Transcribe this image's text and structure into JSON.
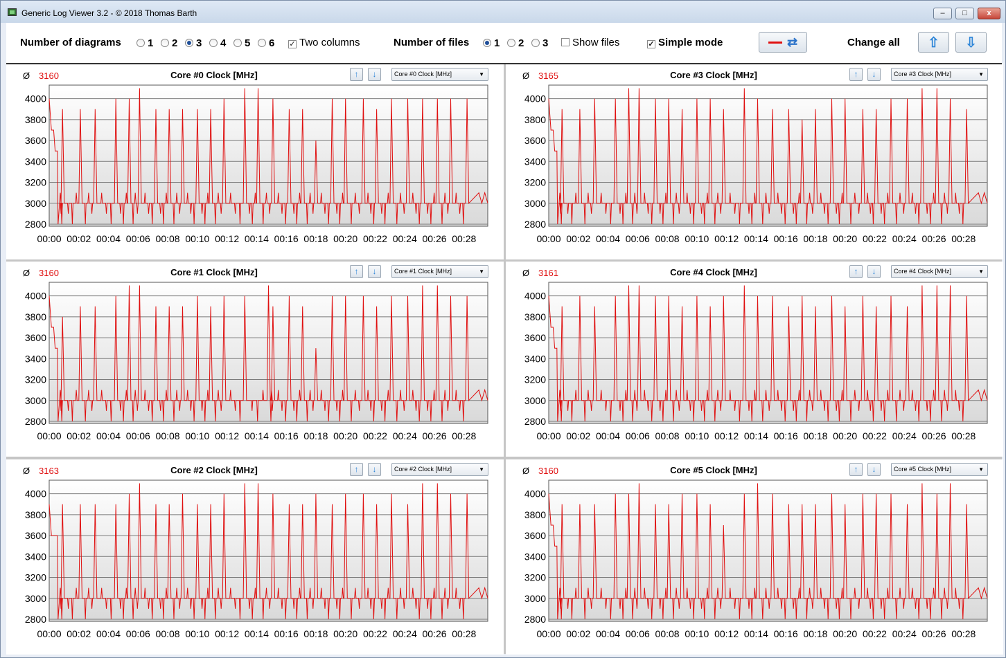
{
  "window": {
    "title": "Generic Log Viewer 3.2 - © 2018 Thomas Barth",
    "min_symbol": "–",
    "max_symbol": "□",
    "close_symbol": "x"
  },
  "toolbar": {
    "diagrams_label": "Number of diagrams",
    "diagram_options": [
      "1",
      "2",
      "3",
      "4",
      "5",
      "6"
    ],
    "diagram_selected": "3",
    "two_columns_label": "Two columns",
    "two_columns_checked": true,
    "files_label": "Number of files",
    "file_options": [
      "1",
      "2",
      "3"
    ],
    "file_selected": "1",
    "show_files_label": "Show files",
    "show_files_checked": false,
    "simple_mode_label": "Simple mode",
    "simple_mode_checked": true,
    "change_all_label": "Change all",
    "check_mark": "✓",
    "up_arrow": "🡅",
    "down_arrow": "🡇",
    "refresh_symbol": "⇄"
  },
  "panel_common": {
    "avg_symbol": "Ø",
    "up_arrow": "↑",
    "down_arrow": "↓",
    "caret": "▼",
    "y_ticks": [
      "4000",
      "3800",
      "3600",
      "3400",
      "3200",
      "3000",
      "2800"
    ],
    "x_ticks": [
      "00:00",
      "00:02",
      "00:04",
      "00:06",
      "00:08",
      "00:10",
      "00:12",
      "00:14",
      "00:16",
      "00:18",
      "00:20",
      "00:22",
      "00:24",
      "00:26",
      "00:28"
    ],
    "line_color": "#e01010"
  },
  "panels": [
    {
      "title": "Core #0 Clock [MHz]",
      "avg": "3160",
      "select": "Core #0 Clock [MHz]"
    },
    {
      "title": "Core #1 Clock [MHz]",
      "avg": "3160",
      "select": "Core #1 Clock [MHz]"
    },
    {
      "title": "Core #2 Clock [MHz]",
      "avg": "3163",
      "select": "Core #2 Clock [MHz]"
    },
    {
      "title": "Core #3 Clock [MHz]",
      "avg": "3165",
      "select": "Core #3 Clock [MHz]"
    },
    {
      "title": "Core #4 Clock [MHz]",
      "avg": "3161",
      "select": "Core #4 Clock [MHz]"
    },
    {
      "title": "Core #5 Clock [MHz]",
      "avg": "3160",
      "select": "Core #5 Clock [MHz]"
    }
  ],
  "chart_data": [
    {
      "type": "line",
      "title": "Core #0 Clock [MHz]",
      "ylim": [
        2780,
        4130
      ],
      "xlim": [
        0,
        29.6
      ],
      "x_unit": "minutes",
      "spike_times": [
        0.9,
        2.1,
        3.1,
        4.5,
        5.4,
        6.1,
        7.2,
        8.1,
        9.0,
        10.0,
        10.9,
        11.8,
        13.2,
        14.1,
        15.1,
        16.2,
        17.1,
        18.0,
        19.1,
        20.0,
        21.2,
        22.1,
        23.1,
        24.2,
        25.2,
        26.2,
        27.1,
        28.2
      ],
      "spike_values": [
        3900,
        3900,
        3900,
        4000,
        4000,
        4100,
        3900,
        3900,
        3900,
        3900,
        3900,
        4000,
        4100,
        4100,
        4000,
        3900,
        3900,
        3600,
        4000,
        4000,
        4000,
        3900,
        4000,
        4000,
        4000,
        4000,
        4000,
        4000
      ],
      "baseline": 3000,
      "start_values": [
        4000,
        3700,
        3500
      ]
    },
    {
      "type": "line",
      "title": "Core #1 Clock [MHz]",
      "ylim": [
        2780,
        4130
      ],
      "xlim": [
        0,
        29.6
      ],
      "x_unit": "minutes",
      "spike_times": [
        0.9,
        2.1,
        3.1,
        4.5,
        5.4,
        6.1,
        7.2,
        8.1,
        9.0,
        10.0,
        10.9,
        11.8,
        13.2,
        14.8,
        15.1,
        16.2,
        17.1,
        18.0,
        19.1,
        20.0,
        21.2,
        22.1,
        23.1,
        24.2,
        25.2,
        26.2,
        27.1,
        28.2
      ],
      "spike_values": [
        3800,
        3900,
        3900,
        4000,
        4100,
        4100,
        3900,
        3900,
        3900,
        4000,
        3900,
        4000,
        4000,
        4100,
        3900,
        4000,
        3900,
        3500,
        4000,
        4000,
        4000,
        3900,
        4000,
        4000,
        4100,
        4100,
        4000,
        4000
      ],
      "baseline": 3000,
      "start_values": [
        4000,
        3700,
        3500
      ]
    },
    {
      "type": "line",
      "title": "Core #2 Clock [MHz]",
      "ylim": [
        2780,
        4130
      ],
      "xlim": [
        0,
        29.6
      ],
      "x_unit": "minutes",
      "spike_times": [
        0.9,
        2.1,
        3.1,
        4.5,
        5.4,
        6.1,
        7.2,
        8.1,
        9.0,
        10.0,
        10.9,
        11.8,
        13.2,
        14.1,
        15.1,
        16.2,
        17.1,
        18.0,
        19.1,
        20.0,
        21.2,
        22.1,
        23.1,
        24.2,
        25.2,
        26.2,
        27.1,
        28.2
      ],
      "spike_values": [
        3900,
        3900,
        3900,
        3900,
        4000,
        4100,
        3900,
        3900,
        4000,
        3900,
        3900,
        4000,
        4100,
        4100,
        4000,
        3900,
        3900,
        4000,
        3900,
        4000,
        4000,
        3900,
        4000,
        3900,
        4100,
        4100,
        4000,
        4000
      ],
      "baseline": 3000,
      "start_values": [
        3900,
        3600,
        3600
      ]
    },
    {
      "type": "line",
      "title": "Core #3 Clock [MHz]",
      "ylim": [
        2780,
        4130
      ],
      "xlim": [
        0,
        29.6
      ],
      "x_unit": "minutes",
      "spike_times": [
        0.9,
        2.1,
        3.1,
        4.5,
        5.4,
        6.1,
        7.2,
        8.1,
        9.0,
        10.0,
        10.9,
        11.8,
        13.2,
        14.1,
        15.1,
        16.2,
        17.1,
        18.0,
        19.1,
        20.0,
        21.2,
        22.1,
        23.1,
        24.2,
        25.2,
        26.2,
        27.1,
        28.2
      ],
      "spike_values": [
        3900,
        3900,
        4000,
        4000,
        4100,
        4100,
        4000,
        4000,
        3900,
        4000,
        4000,
        3900,
        4100,
        4000,
        3900,
        3900,
        3800,
        3900,
        4000,
        4000,
        3900,
        3900,
        4000,
        4000,
        4100,
        4100,
        4000,
        3900
      ],
      "baseline": 3000,
      "start_values": [
        4000,
        3700,
        3500
      ]
    },
    {
      "type": "line",
      "title": "Core #4 Clock [MHz]",
      "ylim": [
        2780,
        4130
      ],
      "xlim": [
        0,
        29.6
      ],
      "x_unit": "minutes",
      "spike_times": [
        0.9,
        2.1,
        3.1,
        4.5,
        5.4,
        6.1,
        7.2,
        8.1,
        9.0,
        10.0,
        10.9,
        11.8,
        13.2,
        14.1,
        15.1,
        16.2,
        17.1,
        18.0,
        19.1,
        20.0,
        21.2,
        22.1,
        23.1,
        24.2,
        25.2,
        26.2,
        27.1,
        28.2
      ],
      "spike_values": [
        3900,
        4000,
        3900,
        4000,
        4100,
        4100,
        4000,
        4000,
        3900,
        4000,
        3900,
        4000,
        4100,
        4000,
        4000,
        3900,
        4000,
        3900,
        4000,
        3900,
        4000,
        3900,
        4000,
        3900,
        4100,
        4100,
        4100,
        4000
      ],
      "baseline": 3000,
      "start_values": [
        4000,
        3700,
        3500
      ]
    },
    {
      "type": "line",
      "title": "Core #5 Clock [MHz]",
      "ylim": [
        2780,
        4130
      ],
      "xlim": [
        0,
        29.6
      ],
      "x_unit": "minutes",
      "spike_times": [
        0.9,
        2.1,
        3.1,
        4.5,
        5.4,
        6.1,
        7.2,
        8.1,
        9.0,
        10.0,
        10.9,
        11.8,
        13.2,
        14.1,
        15.1,
        16.2,
        17.1,
        18.0,
        19.1,
        20.0,
        21.2,
        22.1,
        23.1,
        24.2,
        25.2,
        26.2,
        27.1,
        28.2
      ],
      "spike_values": [
        3900,
        3900,
        3900,
        4000,
        4000,
        4100,
        3900,
        3900,
        4000,
        4000,
        3900,
        3700,
        4000,
        4100,
        4000,
        3900,
        3900,
        3900,
        4000,
        3900,
        4000,
        4000,
        4000,
        3900,
        4100,
        4000,
        4100,
        3900
      ],
      "baseline": 3000,
      "start_values": [
        4000,
        3700,
        3500
      ]
    }
  ]
}
